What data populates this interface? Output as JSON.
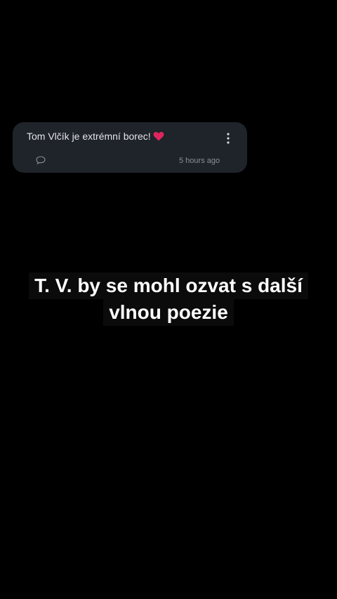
{
  "notification": {
    "message": "Tom Vlčík je extrémní borec!",
    "emoji": "heart-icon",
    "timestamp": "5 hours ago",
    "icons": {
      "menu": "more-vertical-icon",
      "comment": "comment-icon"
    }
  },
  "caption": {
    "line1": "T. V. by se mohl ozvat s další",
    "line2": "vlnou poezie"
  },
  "colors": {
    "background": "#000000",
    "card": "#1f232a",
    "text": "#e4e6ea",
    "muted": "#8b9098",
    "heart": "#e0245e"
  }
}
